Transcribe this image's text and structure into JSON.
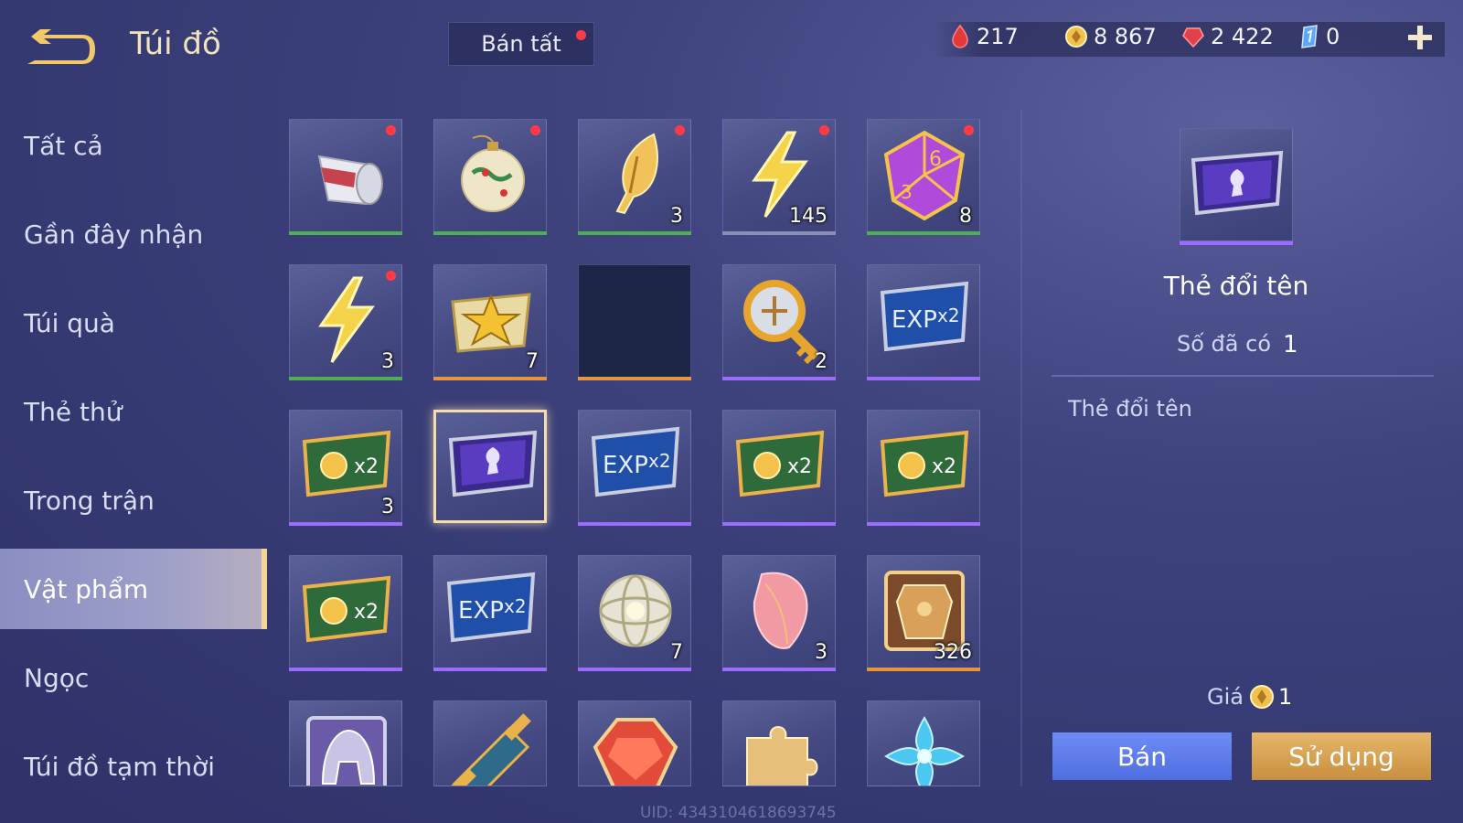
{
  "header": {
    "title": "Túi đồ",
    "sell_all": "Bán tất"
  },
  "currency": [
    {
      "icon": "ruby-drop-icon",
      "value": "217"
    },
    {
      "icon": "gold-coin-icon",
      "value": "8 867"
    },
    {
      "icon": "red-gem-icon",
      "value": "2 422"
    },
    {
      "icon": "blue-crystal-icon",
      "value": "0"
    }
  ],
  "sidebar": {
    "items": [
      {
        "label": "Tất cả"
      },
      {
        "label": "Gần đây nhận"
      },
      {
        "label": "Túi quà"
      },
      {
        "label": "Thẻ thử"
      },
      {
        "label": "Trong trận"
      },
      {
        "label": "Vật phẩm",
        "active": true
      },
      {
        "label": "Ngọc"
      },
      {
        "label": "Túi đồ tạm thời"
      }
    ]
  },
  "grid": [
    {
      "icon": "cup-icon",
      "count": "",
      "dot": true,
      "rarity": "green"
    },
    {
      "icon": "ornament-icon",
      "count": "",
      "dot": true,
      "rarity": "green"
    },
    {
      "icon": "gold-feather-icon",
      "count": "3",
      "dot": true,
      "rarity": "green"
    },
    {
      "icon": "lightning-icon",
      "count": "145",
      "dot": true,
      "rarity": "gray"
    },
    {
      "icon": "dice-icon",
      "count": "8",
      "dot": true,
      "rarity": "green"
    },
    {
      "icon": "lightning-icon",
      "count": "3",
      "dot": true,
      "rarity": "green"
    },
    {
      "icon": "star-badge-icon",
      "count": "7",
      "dot": false,
      "rarity": "orange"
    },
    {
      "icon": "empty",
      "count": "",
      "dot": false,
      "rarity": "orange"
    },
    {
      "icon": "compass-key-icon",
      "count": "2",
      "dot": false,
      "rarity": "purple"
    },
    {
      "icon": "exp-card-icon",
      "count": "",
      "dot": false,
      "rarity": "purple"
    },
    {
      "icon": "gold-x2-card-icon",
      "count": "3",
      "dot": false,
      "rarity": "purple"
    },
    {
      "icon": "rename-card-icon",
      "count": "",
      "dot": false,
      "rarity": "none",
      "selected": true
    },
    {
      "icon": "exp-card-icon",
      "count": "",
      "dot": false,
      "rarity": "purple"
    },
    {
      "icon": "gold-x2-card-icon",
      "count": "",
      "dot": false,
      "rarity": "purple"
    },
    {
      "icon": "gold-x2-card-icon",
      "count": "",
      "dot": false,
      "rarity": "purple"
    },
    {
      "icon": "gold-x2-card-icon",
      "count": "",
      "dot": false,
      "rarity": "purple"
    },
    {
      "icon": "exp-card-icon",
      "count": "",
      "dot": false,
      "rarity": "purple"
    },
    {
      "icon": "silver-orb-icon",
      "count": "7",
      "dot": false,
      "rarity": "purple"
    },
    {
      "icon": "pink-petal-icon",
      "count": "3",
      "dot": false,
      "rarity": "purple"
    },
    {
      "icon": "armor-chest-icon",
      "count": "326",
      "dot": false,
      "rarity": "orange"
    },
    {
      "icon": "helmet-icon",
      "count": "",
      "dot": false,
      "rarity": "none"
    },
    {
      "icon": "scroll-icon",
      "count": "",
      "dot": false,
      "rarity": "none"
    },
    {
      "icon": "red-gem-icon",
      "count": "",
      "dot": false,
      "rarity": "none"
    },
    {
      "icon": "puzzle-piece-icon",
      "count": "",
      "dot": false,
      "rarity": "none"
    },
    {
      "icon": "blue-flower-icon",
      "count": "",
      "dot": false,
      "rarity": "none"
    }
  ],
  "detail": {
    "name": "Thẻ đổi tên",
    "owned_label": "Số đã có",
    "owned_value": "1",
    "description": "Thẻ đổi tên",
    "price_label": "Giá",
    "price_value": "1",
    "sell_button": "Bán",
    "use_button": "Sử dụng"
  },
  "footer": {
    "uid": "UID: 4343104618693745"
  },
  "colors": {
    "green": "#4caf50",
    "orange": "#e8943a",
    "purple": "#9b6cff",
    "gray": "#8a8fb5",
    "accent": "#f2d597"
  }
}
